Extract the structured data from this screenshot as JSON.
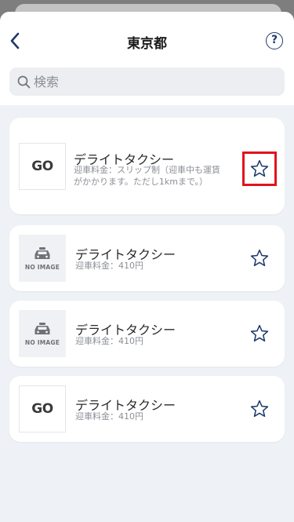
{
  "header": {
    "title": "東京都",
    "help_label": "?"
  },
  "search": {
    "placeholder": "検索"
  },
  "colors": {
    "accent": "#1e3a6b",
    "highlight": "#e1141d",
    "background": "#eef2f6"
  },
  "items": [
    {
      "name": "デライトタクシー",
      "fee_line1": "迎車料金：スリップ制（迎車中も運賃",
      "fee_line2": "がかかります。ただし1kmまで。）",
      "logo": "GO",
      "favorite_icon": "star-outline-icon"
    },
    {
      "name": "デライトタクシー",
      "fee_line1": "迎車料金：410円",
      "logo_label": "NO IMAGE",
      "favorite_icon": "star-outline-icon"
    },
    {
      "name": "デライトタクシー",
      "fee_line1": "迎車料金：410円",
      "logo_label": "NO IMAGE",
      "favorite_icon": "star-outline-icon"
    },
    {
      "name": "デライトタクシー",
      "fee_line1": "迎車料金：410円",
      "logo": "GO",
      "favorite_icon": "star-outline-icon"
    }
  ]
}
